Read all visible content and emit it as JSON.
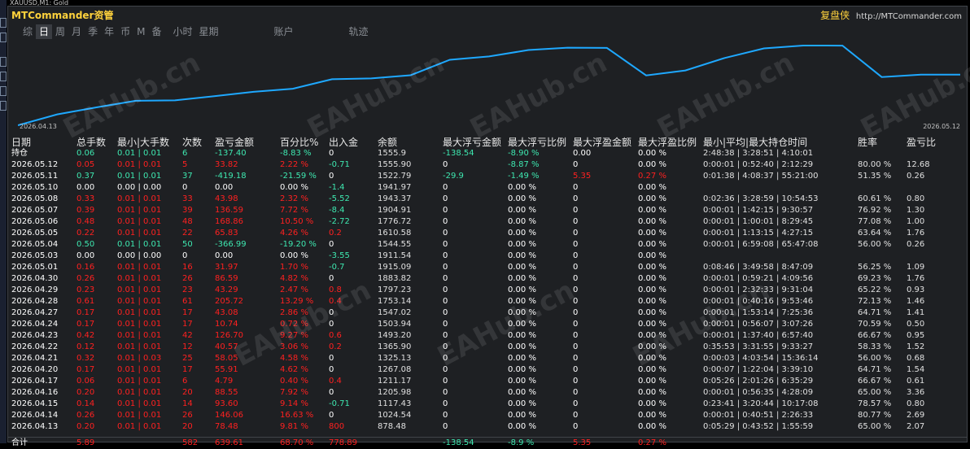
{
  "window_title": "XAUUSD,M1: Gold",
  "brand": {
    "name": "MTCommander资管",
    "right_label": "复盘侠",
    "right_url": "http://MTCommander.com"
  },
  "tabs": [
    "综",
    "日",
    "周",
    "月",
    "季",
    "年",
    "币",
    "M",
    "备",
    "小时",
    "星期",
    "账户",
    "轨迹"
  ],
  "active_tab": 1,
  "chart_data": {
    "type": "line",
    "x_start_label": "2026.04.13",
    "x_end_label": "2026.05.12",
    "values": [
      878.48,
      1024.54,
      1117.43,
      1205.98,
      1211.17,
      1267.08,
      1325.13,
      1365.9,
      1493.2,
      1503.94,
      1547.02,
      1753.14,
      1797.23,
      1883.82,
      1915.09,
      1911.54,
      1544.55,
      1610.58,
      1776.72,
      1904.91,
      1943.37,
      1941.97,
      1522.79,
      1555.9,
      1555.9
    ],
    "color": "#1ea8ff"
  },
  "headers": [
    "日期",
    "总手数",
    "最小|大手数",
    "次数",
    "盈亏金额",
    "百分比%",
    "出入金",
    "余额",
    "最大浮亏金额",
    "最大浮亏比例",
    "最大浮盈金额",
    "最大浮盈比例",
    "最小|平均|最大持仓时间",
    "胜率",
    "盈亏比"
  ],
  "holding_row": {
    "date": "持仓",
    "lots": "0.06",
    "minmax": "0.01 | 0.01",
    "count": "6",
    "pnl": "-137.40",
    "pct": "-8.83 %",
    "io": "0",
    "bal": "1555.9",
    "mfl": "-138.54",
    "mflp": "-8.90 %",
    "mfp": "0.00",
    "mfpp": "0.00 %",
    "time": "2:48:38 | 3:28:51 | 4:10:01",
    "win": "",
    "rr": ""
  },
  "rows": [
    {
      "date": "2026.05.12",
      "lots": "0.05",
      "minmax": "0.01 | 0.01",
      "count": "5",
      "pnl": "33.82",
      "pct": "2.22 %",
      "io": "-0.71",
      "bal": "1555.90",
      "mfl": "0",
      "mflp": "-8.87 %",
      "mfp": "0",
      "mfpp": "0.00 %",
      "time": "0:00:01 | 0:52:40 | 2:12:29",
      "win": "80.00 %",
      "rr": "12.68",
      "tone": "red"
    },
    {
      "date": "2026.05.11",
      "lots": "0.37",
      "minmax": "0.01 | 0.01",
      "count": "37",
      "pnl": "-419.18",
      "pct": "-21.59 %",
      "io": "0",
      "bal": "1522.79",
      "mfl": "-29.9",
      "mflp": "-1.49 %",
      "mfp": "5.35",
      "mfpp": "0.27 %",
      "time": "0:01:38 | 4:08:37 | 55:21:00",
      "win": "51.35 %",
      "rr": "0.26",
      "tone": "green"
    },
    {
      "date": "2026.05.10",
      "lots": "0.00",
      "minmax": "0.00 | 0.00",
      "count": "0",
      "pnl": "0.00",
      "pct": "0.00 %",
      "io": "-1.4",
      "bal": "1941.97",
      "mfl": "0",
      "mflp": "0.00 %",
      "mfp": "0",
      "mfpp": "0.00 %",
      "time": "",
      "win": "",
      "rr": "",
      "tone": "white"
    },
    {
      "date": "2026.05.08",
      "lots": "0.33",
      "minmax": "0.01 | 0.01",
      "count": "33",
      "pnl": "43.98",
      "pct": "2.32 %",
      "io": "-5.52",
      "bal": "1943.37",
      "mfl": "0",
      "mflp": "0.00 %",
      "mfp": "0",
      "mfpp": "0.00 %",
      "time": "0:02:36 | 3:28:59 | 10:54:53",
      "win": "60.61 %",
      "rr": "0.80",
      "tone": "red"
    },
    {
      "date": "2026.05.07",
      "lots": "0.39",
      "minmax": "0.01 | 0.01",
      "count": "39",
      "pnl": "136.59",
      "pct": "7.72 %",
      "io": "-8.4",
      "bal": "1904.91",
      "mfl": "0",
      "mflp": "0.00 %",
      "mfp": "0",
      "mfpp": "0.00 %",
      "time": "0:00:01 | 1:42:15 | 9:30:57",
      "win": "76.92 %",
      "rr": "1.30",
      "tone": "red"
    },
    {
      "date": "2026.05.06",
      "lots": "0.48",
      "minmax": "0.01 | 0.01",
      "count": "48",
      "pnl": "168.86",
      "pct": "10.50 %",
      "io": "-2.72",
      "bal": "1776.72",
      "mfl": "0",
      "mflp": "0.00 %",
      "mfp": "0",
      "mfpp": "0.00 %",
      "time": "0:00:01 | 1:00:01 | 8:29:45",
      "win": "77.08 %",
      "rr": "1.00",
      "tone": "red"
    },
    {
      "date": "2026.05.05",
      "lots": "0.22",
      "minmax": "0.01 | 0.01",
      "count": "22",
      "pnl": "65.83",
      "pct": "4.26 %",
      "io": "0.2",
      "bal": "1610.58",
      "mfl": "0",
      "mflp": "0.00 %",
      "mfp": "0",
      "mfpp": "0.00 %",
      "time": "0:00:01 | 1:13:15 | 4:27:15",
      "win": "63.64 %",
      "rr": "1.76",
      "tone": "red"
    },
    {
      "date": "2026.05.04",
      "lots": "0.50",
      "minmax": "0.01 | 0.01",
      "count": "50",
      "pnl": "-366.99",
      "pct": "-19.20 %",
      "io": "0",
      "bal": "1544.55",
      "mfl": "0",
      "mflp": "0.00 %",
      "mfp": "0",
      "mfpp": "0.00 %",
      "time": "0:00:01 | 6:59:08 | 65:47:08",
      "win": "56.00 %",
      "rr": "0.26",
      "tone": "green"
    },
    {
      "date": "2026.05.03",
      "lots": "0.00",
      "minmax": "0.00 | 0.00",
      "count": "0",
      "pnl": "0.00",
      "pct": "0.00 %",
      "io": "-3.55",
      "bal": "1911.54",
      "mfl": "0",
      "mflp": "0.00 %",
      "mfp": "0",
      "mfpp": "0.00 %",
      "time": "",
      "win": "",
      "rr": "",
      "tone": "white"
    },
    {
      "date": "2026.05.01",
      "lots": "0.16",
      "minmax": "0.01 | 0.01",
      "count": "16",
      "pnl": "31.97",
      "pct": "1.70 %",
      "io": "-0.7",
      "bal": "1915.09",
      "mfl": "0",
      "mflp": "0.00 %",
      "mfp": "0",
      "mfpp": "0.00 %",
      "time": "0:08:46 | 3:49:58 | 8:47:09",
      "win": "56.25 %",
      "rr": "1.09",
      "tone": "red"
    },
    {
      "date": "2026.04.30",
      "lots": "0.26",
      "minmax": "0.01 | 0.01",
      "count": "26",
      "pnl": "86.59",
      "pct": "4.82 %",
      "io": "0",
      "bal": "1883.82",
      "mfl": "0",
      "mflp": "0.00 %",
      "mfp": "0",
      "mfpp": "0.00 %",
      "time": "0:00:01 | 0:59:21 | 4:09:56",
      "win": "69.23 %",
      "rr": "1.76",
      "tone": "red"
    },
    {
      "date": "2026.04.29",
      "lots": "0.23",
      "minmax": "0.01 | 0.01",
      "count": "23",
      "pnl": "43.29",
      "pct": "2.47 %",
      "io": "0.8",
      "bal": "1797.23",
      "mfl": "0",
      "mflp": "0.00 %",
      "mfp": "0",
      "mfpp": "0.00 %",
      "time": "0:00:01 | 2:32:33 | 9:31:04",
      "win": "65.22 %",
      "rr": "0.93",
      "tone": "red"
    },
    {
      "date": "2026.04.28",
      "lots": "0.61",
      "minmax": "0.01 | 0.01",
      "count": "61",
      "pnl": "205.72",
      "pct": "13.29 %",
      "io": "0.4",
      "bal": "1753.14",
      "mfl": "0",
      "mflp": "0.00 %",
      "mfp": "0",
      "mfpp": "0.00 %",
      "time": "0:00:01 | 0:40:16 | 9:53:46",
      "win": "72.13 %",
      "rr": "1.46",
      "tone": "red"
    },
    {
      "date": "2026.04.27",
      "lots": "0.17",
      "minmax": "0.01 | 0.01",
      "count": "17",
      "pnl": "43.08",
      "pct": "2.86 %",
      "io": "0",
      "bal": "1547.02",
      "mfl": "0",
      "mflp": "0.00 %",
      "mfp": "0",
      "mfpp": "0.00 %",
      "time": "0:00:01 | 1:53:14 | 7:25:36",
      "win": "64.71 %",
      "rr": "1.41",
      "tone": "red"
    },
    {
      "date": "2026.04.24",
      "lots": "0.17",
      "minmax": "0.01 | 0.01",
      "count": "17",
      "pnl": "10.74",
      "pct": "0.72 %",
      "io": "0",
      "bal": "1503.94",
      "mfl": "0",
      "mflp": "0.00 %",
      "mfp": "0",
      "mfpp": "0.00 %",
      "time": "0:00:01 | 0:56:07 | 3:07:26",
      "win": "70.59 %",
      "rr": "0.50",
      "tone": "red"
    },
    {
      "date": "2026.04.23",
      "lots": "0.42",
      "minmax": "0.01 | 0.01",
      "count": "42",
      "pnl": "126.70",
      "pct": "9.27 %",
      "io": "0.6",
      "bal": "1493.20",
      "mfl": "0",
      "mflp": "0.00 %",
      "mfp": "0",
      "mfpp": "0.00 %",
      "time": "0:00:01 | 1:37:40 | 6:57:40",
      "win": "66.67 %",
      "rr": "0.95",
      "tone": "red"
    },
    {
      "date": "2026.04.22",
      "lots": "0.12",
      "minmax": "0.01 | 0.01",
      "count": "12",
      "pnl": "40.57",
      "pct": "3.06 %",
      "io": "0.2",
      "bal": "1365.90",
      "mfl": "0",
      "mflp": "0.00 %",
      "mfp": "0",
      "mfpp": "0.00 %",
      "time": "0:35:53 | 3:31:55 | 9:33:27",
      "win": "58.33 %",
      "rr": "1.52",
      "tone": "red"
    },
    {
      "date": "2026.04.21",
      "lots": "0.32",
      "minmax": "0.01 | 0.03",
      "count": "25",
      "pnl": "58.05",
      "pct": "4.58 %",
      "io": "0",
      "bal": "1325.13",
      "mfl": "0",
      "mflp": "0.00 %",
      "mfp": "0",
      "mfpp": "0.00 %",
      "time": "0:00:03 | 4:03:54 | 15:36:14",
      "win": "56.00 %",
      "rr": "0.68",
      "tone": "red"
    },
    {
      "date": "2026.04.20",
      "lots": "0.17",
      "minmax": "0.01 | 0.01",
      "count": "17",
      "pnl": "55.91",
      "pct": "4.62 %",
      "io": "0",
      "bal": "1267.08",
      "mfl": "0",
      "mflp": "0.00 %",
      "mfp": "0",
      "mfpp": "0.00 %",
      "time": "0:00:07 | 1:22:04 | 3:39:10",
      "win": "64.71 %",
      "rr": "1.54",
      "tone": "red"
    },
    {
      "date": "2026.04.17",
      "lots": "0.06",
      "minmax": "0.01 | 0.01",
      "count": "6",
      "pnl": "4.79",
      "pct": "0.40 %",
      "io": "0.4",
      "bal": "1211.17",
      "mfl": "0",
      "mflp": "0.00 %",
      "mfp": "0",
      "mfpp": "0.00 %",
      "time": "0:05:26 | 2:01:26 | 6:35:29",
      "win": "66.67 %",
      "rr": "0.61",
      "tone": "red"
    },
    {
      "date": "2026.04.16",
      "lots": "0.20",
      "minmax": "0.01 | 0.01",
      "count": "20",
      "pnl": "88.55",
      "pct": "7.92 %",
      "io": "0",
      "bal": "1205.98",
      "mfl": "0",
      "mflp": "0.00 %",
      "mfp": "0",
      "mfpp": "0.00 %",
      "time": "0:00:01 | 0:56:35 | 4:28:09",
      "win": "65.00 %",
      "rr": "3.36",
      "tone": "red"
    },
    {
      "date": "2026.04.15",
      "lots": "0.14",
      "minmax": "0.01 | 0.01",
      "count": "14",
      "pnl": "93.60",
      "pct": "9.14 %",
      "io": "-0.71",
      "bal": "1117.43",
      "mfl": "0",
      "mflp": "0.00 %",
      "mfp": "0",
      "mfpp": "0.00 %",
      "time": "0:23:41 | 3:20:44 | 10:17:08",
      "win": "78.57 %",
      "rr": "0.80",
      "tone": "red"
    },
    {
      "date": "2026.04.14",
      "lots": "0.26",
      "minmax": "0.01 | 0.01",
      "count": "26",
      "pnl": "146.06",
      "pct": "16.63 %",
      "io": "0",
      "bal": "1024.54",
      "mfl": "0",
      "mflp": "0.00 %",
      "mfp": "0",
      "mfpp": "0.00 %",
      "time": "0:00:01 | 0:40:51 | 2:26:33",
      "win": "80.77 %",
      "rr": "2.69",
      "tone": "red"
    },
    {
      "date": "2026.04.13",
      "lots": "0.20",
      "minmax": "0.01 | 0.01",
      "count": "20",
      "pnl": "78.48",
      "pct": "9.81 %",
      "io": "800",
      "bal": "878.48",
      "mfl": "0",
      "mflp": "0.00 %",
      "mfp": "0",
      "mfpp": "0.00 %",
      "time": "0:05:29 | 0:43:52 | 1:55:59",
      "win": "65.00 %",
      "rr": "2.07",
      "tone": "red"
    }
  ],
  "total_row": {
    "date": "合计",
    "lots": "5.89",
    "count": "582",
    "pnl": "639.61",
    "pct": "68.70 %",
    "io": "778.89",
    "mfl": "-138.54",
    "mflp": "-8.9 %",
    "mfp": "5.35",
    "mfpp": "0.27 %"
  },
  "watermark": "EAHub.cn"
}
